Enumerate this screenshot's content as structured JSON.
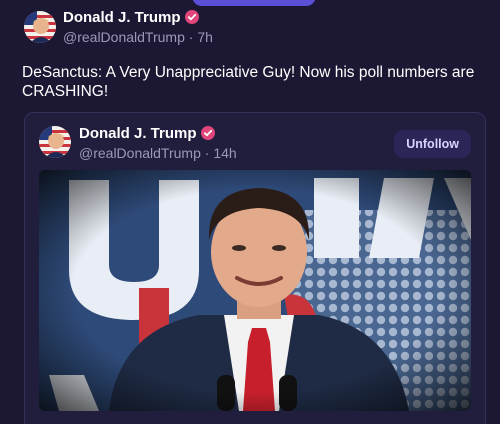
{
  "post": {
    "author_name": "Donald J. Trump",
    "handle": "@realDonaldTrump",
    "separator": "·",
    "time": "7h",
    "text": "DeSanctus: A Very Unappreciative Guy! Now his poll numbers are CRASHING!"
  },
  "quote": {
    "author_name": "Donald J. Trump",
    "handle": "@realDonaldTrump",
    "separator": "·",
    "time": "14h",
    "unfollow_label": "Unfollow"
  },
  "icons": {
    "verified": "verified-badge-icon",
    "avatar": "avatar-flag-portrait"
  },
  "colors": {
    "background": "#1c1833",
    "card": "#211d3c",
    "verified": "#e0457b",
    "accent": "#5b4fd8",
    "muted_text": "#9c98b8"
  }
}
